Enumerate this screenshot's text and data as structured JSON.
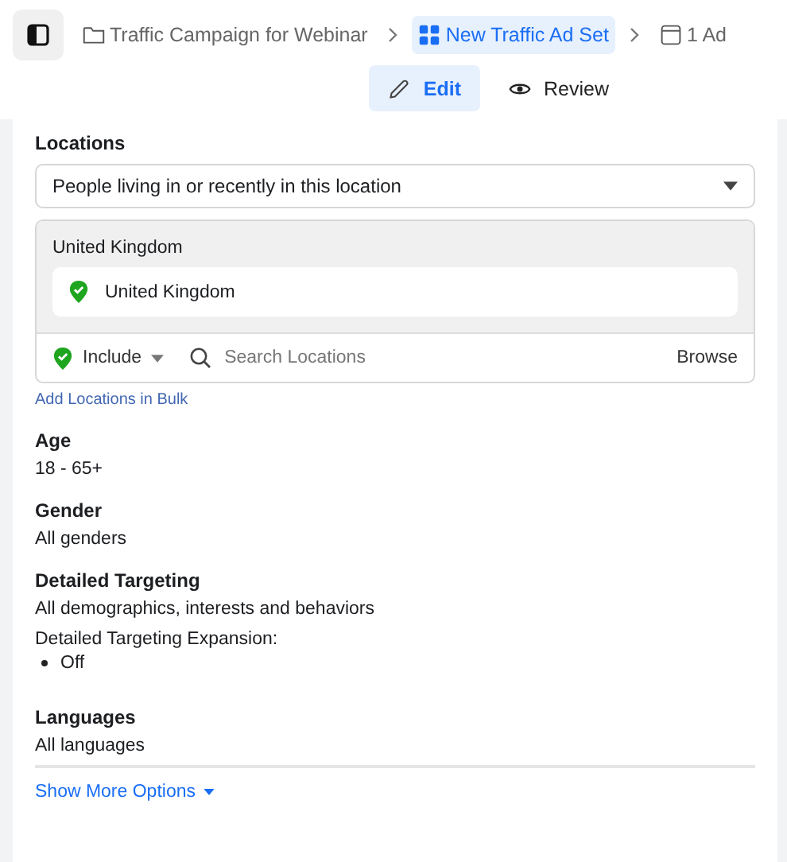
{
  "breadcrumb": [
    {
      "label": "Traffic Campaign for Webinar",
      "kind": "campaign",
      "selected": false
    },
    {
      "label": "New Traffic Ad Set",
      "kind": "adset",
      "selected": true
    },
    {
      "label": "1 Ad",
      "kind": "ad",
      "selected": false
    }
  ],
  "modes": [
    {
      "label": "Edit",
      "kind": "edit",
      "selected": true
    },
    {
      "label": "Review",
      "kind": "review",
      "selected": false
    }
  ],
  "locations": {
    "label": "Locations",
    "dropdown": "People living in or recently in this location",
    "group_title": "United Kingdom",
    "items": [
      "United Kingdom"
    ],
    "include": "Include",
    "search_placeholder": "Search Locations",
    "browse": "Browse",
    "bulk_link": "Add Locations in Bulk"
  },
  "sections": [
    {
      "label": "Age",
      "value": "18 - 65+"
    },
    {
      "label": "Gender",
      "value": "All genders"
    },
    {
      "label": "Detailed Targeting",
      "value": "All demographics, interests and behaviors",
      "note": "Detailed Targeting Expansion:",
      "note_items": [
        "Off"
      ]
    },
    {
      "label": "Languages",
      "value": "All languages"
    }
  ],
  "more_options": "Show More Options"
}
